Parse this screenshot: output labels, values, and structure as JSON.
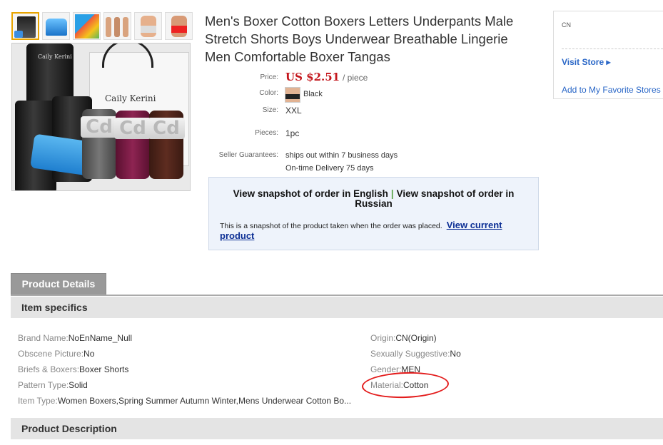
{
  "thumbnails": [
    {
      "name": "thumb-1",
      "active": true
    },
    {
      "name": "thumb-2",
      "active": false
    },
    {
      "name": "thumb-3",
      "active": false
    },
    {
      "name": "thumb-4",
      "active": false
    },
    {
      "name": "thumb-5",
      "active": false
    },
    {
      "name": "thumb-6",
      "active": false
    }
  ],
  "image": {
    "bag_brand": "Caily Kerini",
    "can_brand": "Caily Kerini",
    "band_text": "Cd"
  },
  "product": {
    "title": "Men's Boxer Cotton Boxers Letters Underpants Male Stretch Shorts Boys Underwear Breathable Lingerie Men Comfortable Boxer Tangas",
    "price_label": "Price:",
    "price_amount": "US $2.51",
    "price_unit": "/ piece",
    "color_label": "Color:",
    "color_value": "Black",
    "size_label": "Size:",
    "size_value": "XXL",
    "pieces_label": "Pieces:",
    "pieces_value": "1pc",
    "guarantee_label": "Seller Guarantees:",
    "guarantee_line1": "ships out within 7 business days",
    "guarantee_line2": "On-time Delivery 75 days"
  },
  "snapshot": {
    "link_english": "View snapshot of order in English",
    "separator": "|",
    "link_russian": "View snapshot of order in Russian",
    "notice": "This is a snapshot of the product taken when the order was placed.",
    "view_current": "View current product"
  },
  "store": {
    "country": "CN",
    "visit": "Visit Store",
    "visit_arrow": "▸",
    "favorite": "Add to My Favorite Stores"
  },
  "tabs": {
    "product_details": "Product Details"
  },
  "sections": {
    "item_specifics": "Item specifics",
    "product_description": "Product Description"
  },
  "specs_left": [
    {
      "key": "Brand Name:",
      "value": "NoEnName_Null"
    },
    {
      "key": "Obscene Picture:",
      "value": "No"
    },
    {
      "key": "Briefs & Boxers:",
      "value": "Boxer Shorts"
    },
    {
      "key": "Pattern Type:",
      "value": "Solid"
    },
    {
      "key": "Item Type:",
      "value": "Women Boxers,Spring Summer Autumn Winter,Mens Underwear Cotton Bo..."
    }
  ],
  "specs_right": [
    {
      "key": "Origin:",
      "value": "CN(Origin)"
    },
    {
      "key": "Sexually Suggestive:",
      "value": "No"
    },
    {
      "key": "Gender:",
      "value": "MEN"
    },
    {
      "key": "Material:",
      "value": "Cotton"
    }
  ],
  "annotation": {
    "color": "#e31b1b",
    "target": "Material:Cotton"
  }
}
